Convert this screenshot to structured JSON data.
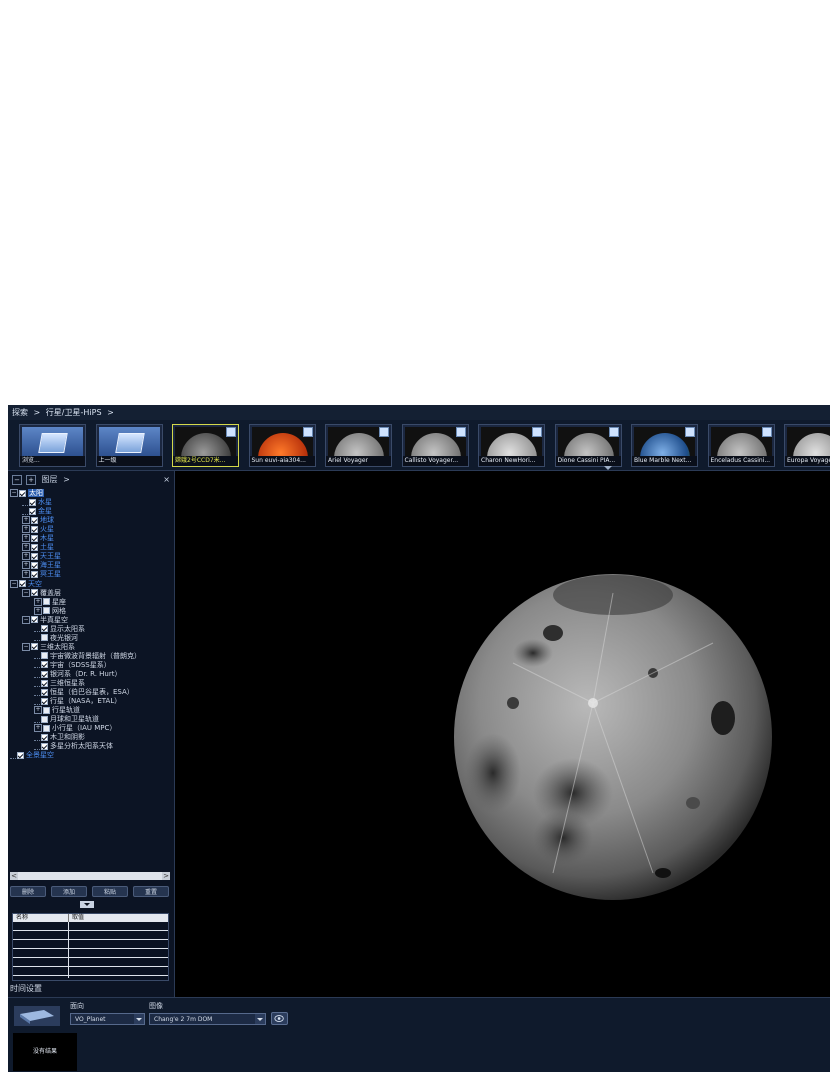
{
  "breadcrumb": {
    "items": [
      "探索",
      ">",
      "行星/卫星-HiPS",
      ">"
    ]
  },
  "thumbnails": [
    {
      "label": "浏览...",
      "kind": "folder-browse",
      "selected": false
    },
    {
      "label": "上一级",
      "kind": "folder-up",
      "selected": false
    },
    {
      "label": "嫦娥2号CCD7米...",
      "kind": "moon",
      "selected": true
    },
    {
      "label": "Sun euvi-aia304...",
      "kind": "sun",
      "selected": false
    },
    {
      "label": "Ariel Voyager",
      "kind": "grey",
      "selected": false
    },
    {
      "label": "Callisto Voyager...",
      "kind": "grey",
      "selected": false
    },
    {
      "label": "Charon NewHori...",
      "kind": "grey-light",
      "selected": false
    },
    {
      "label": "Dione Cassini PIA...",
      "kind": "grey",
      "selected": false
    },
    {
      "label": "Blue Marble Next...",
      "kind": "earth",
      "selected": false
    },
    {
      "label": "Enceladus Cassini...",
      "kind": "grey",
      "selected": false
    },
    {
      "label": "Europa Voyager",
      "kind": "grey-light",
      "selected": false
    }
  ],
  "layers_panel": {
    "title": "图层",
    "arrow": ">",
    "close": "×",
    "tree": [
      {
        "label": "太阳",
        "depth": 0,
        "expander": "−",
        "checked": true,
        "style": "sel"
      },
      {
        "label": "水星",
        "depth": 1,
        "expander": "",
        "checked": true,
        "style": "blue"
      },
      {
        "label": "金星",
        "depth": 1,
        "expander": "",
        "checked": true,
        "style": "blue"
      },
      {
        "label": "地球",
        "depth": 1,
        "expander": "+",
        "checked": true,
        "style": "blue"
      },
      {
        "label": "火星",
        "depth": 1,
        "expander": "+",
        "checked": true,
        "style": "blue"
      },
      {
        "label": "木星",
        "depth": 1,
        "expander": "+",
        "checked": true,
        "style": "blue"
      },
      {
        "label": "土星",
        "depth": 1,
        "expander": "+",
        "checked": true,
        "style": "blue"
      },
      {
        "label": "天王星",
        "depth": 1,
        "expander": "+",
        "checked": true,
        "style": "blue"
      },
      {
        "label": "海王星",
        "depth": 1,
        "expander": "+",
        "checked": true,
        "style": "blue"
      },
      {
        "label": "冥王星",
        "depth": 1,
        "expander": "+",
        "checked": true,
        "style": "blue"
      },
      {
        "label": "天空",
        "depth": 0,
        "expander": "−",
        "checked": true,
        "style": "blue"
      },
      {
        "label": "覆盖层",
        "depth": 1,
        "expander": "−",
        "checked": true,
        "style": ""
      },
      {
        "label": "星座",
        "depth": 2,
        "expander": "+",
        "checked": false,
        "style": ""
      },
      {
        "label": "网格",
        "depth": 2,
        "expander": "+",
        "checked": false,
        "style": ""
      },
      {
        "label": "半真星空",
        "depth": 1,
        "expander": "−",
        "checked": true,
        "style": ""
      },
      {
        "label": "显示太阳系",
        "depth": 2,
        "expander": "",
        "checked": true,
        "style": ""
      },
      {
        "label": "夜光银河",
        "depth": 2,
        "expander": "",
        "checked": false,
        "style": ""
      },
      {
        "label": "三维太阳系",
        "depth": 1,
        "expander": "−",
        "checked": true,
        "style": ""
      },
      {
        "label": "宇宙微波背景辐射（普朗克）",
        "depth": 2,
        "expander": "",
        "checked": false,
        "style": ""
      },
      {
        "label": "宇宙（SDSS星系）",
        "depth": 2,
        "expander": "",
        "checked": true,
        "style": ""
      },
      {
        "label": "银河系（Dr. R. Hurt）",
        "depth": 2,
        "expander": "",
        "checked": true,
        "style": ""
      },
      {
        "label": "三维恒星系",
        "depth": 2,
        "expander": "",
        "checked": true,
        "style": ""
      },
      {
        "label": "恒星（伯巴谷星表，ESA）",
        "depth": 2,
        "expander": "",
        "checked": true,
        "style": ""
      },
      {
        "label": "行星（NASA，ETAL）",
        "depth": 2,
        "expander": "",
        "checked": true,
        "style": ""
      },
      {
        "label": "行星轨道",
        "depth": 2,
        "expander": "+",
        "checked": false,
        "style": ""
      },
      {
        "label": "月球和卫星轨道",
        "depth": 2,
        "expander": "",
        "checked": false,
        "style": ""
      },
      {
        "label": "小行星（IAU MPC）",
        "depth": 2,
        "expander": "+",
        "checked": false,
        "style": ""
      },
      {
        "label": "木卫和阴影",
        "depth": 2,
        "expander": "",
        "checked": true,
        "style": ""
      },
      {
        "label": "多星分析太阳系天体",
        "depth": 2,
        "expander": "",
        "checked": true,
        "style": ""
      },
      {
        "label": "全景星空",
        "depth": 0,
        "expander": "",
        "checked": true,
        "style": "blue"
      }
    ],
    "scroll_left": "<",
    "scroll_right": ">",
    "buttons": [
      "删除",
      "添加",
      "粘贴",
      "重置"
    ],
    "property_table": {
      "headers": [
        "名称",
        "取值"
      ],
      "rows": 6
    },
    "time_label": "时间设置"
  },
  "bottom_bar": {
    "direction_label": "面向",
    "direction_value": "VO_Planet",
    "image_label": "图像",
    "image_value": "Chang'e 2 7m DOM",
    "no_result": "没有结果"
  }
}
